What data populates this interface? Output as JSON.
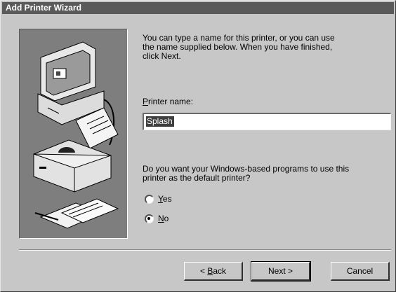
{
  "window": {
    "title": "Add Printer Wizard"
  },
  "intro": {
    "line1": "You can type a name for this printer, or you can use",
    "line2": "the name supplied below. When you have finished,",
    "line3": "click Next."
  },
  "printer_name": {
    "label_hotkey": "P",
    "label_rest": "rinter name:",
    "value": "Splash"
  },
  "default_question": {
    "line1": "Do you want your Windows-based programs to use this",
    "line2": "printer as the default printer?"
  },
  "options": {
    "yes": {
      "hotkey": "Y",
      "rest": "es",
      "selected": false
    },
    "no": {
      "hotkey": "N",
      "rest": "o",
      "selected": true
    }
  },
  "buttons": {
    "back_prefix": "< ",
    "back_hotkey": "B",
    "back_rest": "ack",
    "next": "Next >",
    "cancel": "Cancel"
  }
}
